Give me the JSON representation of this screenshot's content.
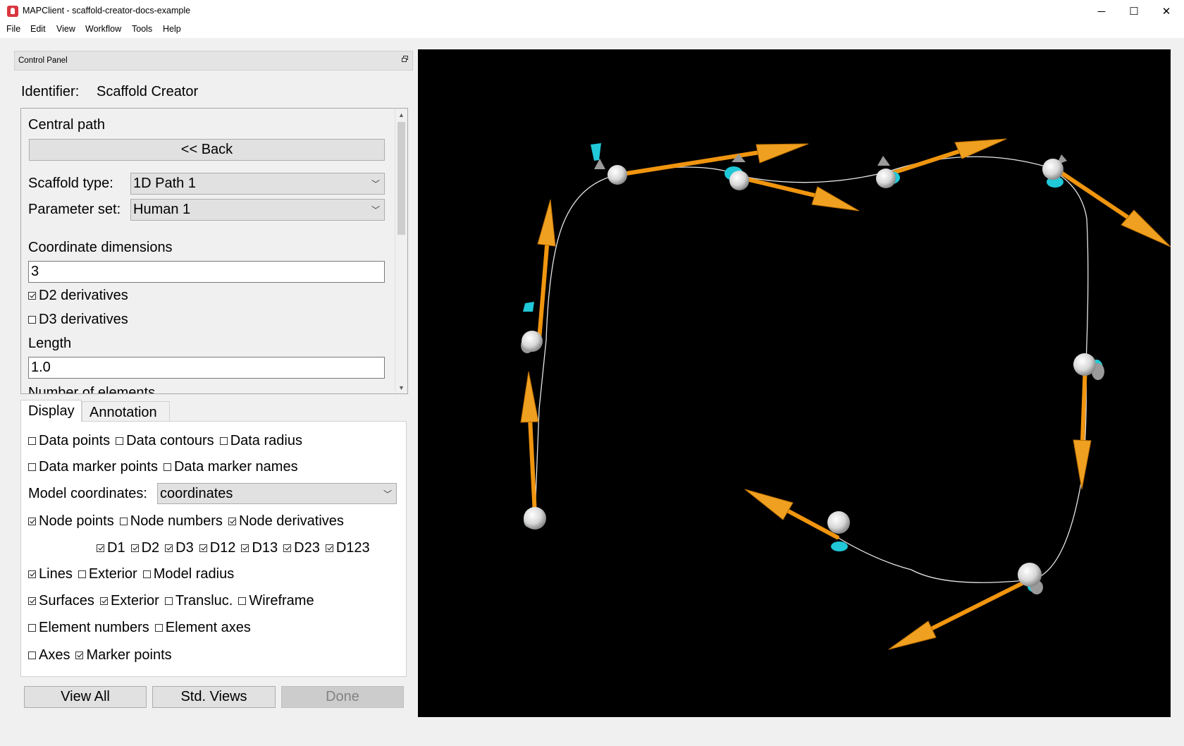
{
  "window": {
    "title": "MAPClient - scaffold-creator-docs-example",
    "controls": {
      "minimize": "─",
      "maximize": "☐",
      "close": "✕"
    }
  },
  "menu": [
    "File",
    "Edit",
    "View",
    "Workflow",
    "Tools",
    "Help"
  ],
  "control_panel": {
    "title": "Control Panel",
    "identifier_label": "Identifier:",
    "identifier_value": "Scaffold Creator"
  },
  "settings": {
    "heading": "Central path",
    "back_label": "<< Back",
    "scaffold_type_label": "Scaffold type:",
    "scaffold_type_value": "1D Path 1",
    "parameter_set_label": "Parameter set:",
    "parameter_set_value": "Human 1",
    "coord_dims_label": "Coordinate dimensions",
    "coord_dims_value": "3",
    "d2_label": "D2 derivatives",
    "d2_checked": true,
    "d3_label": "D3 derivatives",
    "d3_checked": false,
    "length_label": "Length",
    "length_value": "1.0",
    "num_elements_label": "Number of elements"
  },
  "tabs": {
    "display": "Display",
    "annotation": "Annotation"
  },
  "display": {
    "data_points": "Data points",
    "data_contours": "Data contours",
    "data_radius": "Data radius",
    "data_marker_points": "Data marker points",
    "data_marker_names": "Data marker names",
    "model_coords_label": "Model coordinates:",
    "model_coords_value": "coordinates",
    "node_points": "Node points",
    "node_numbers": "Node numbers",
    "node_derivatives": "Node derivatives",
    "d1": "D1",
    "d2": "D2",
    "d3": "D3",
    "d12": "D12",
    "d13": "D13",
    "d23": "D23",
    "d123": "D123",
    "lines": "Lines",
    "lines_exterior": "Exterior",
    "model_radius": "Model radius",
    "surfaces": "Surfaces",
    "surfaces_exterior": "Exterior",
    "transluc": "Transluc.",
    "wireframe": "Wireframe",
    "element_numbers": "Element numbers",
    "element_axes": "Element axes",
    "axes": "Axes",
    "marker_points": "Marker points"
  },
  "buttons": {
    "view_all": "View All",
    "std_views": "Std. Views",
    "done": "Done"
  }
}
